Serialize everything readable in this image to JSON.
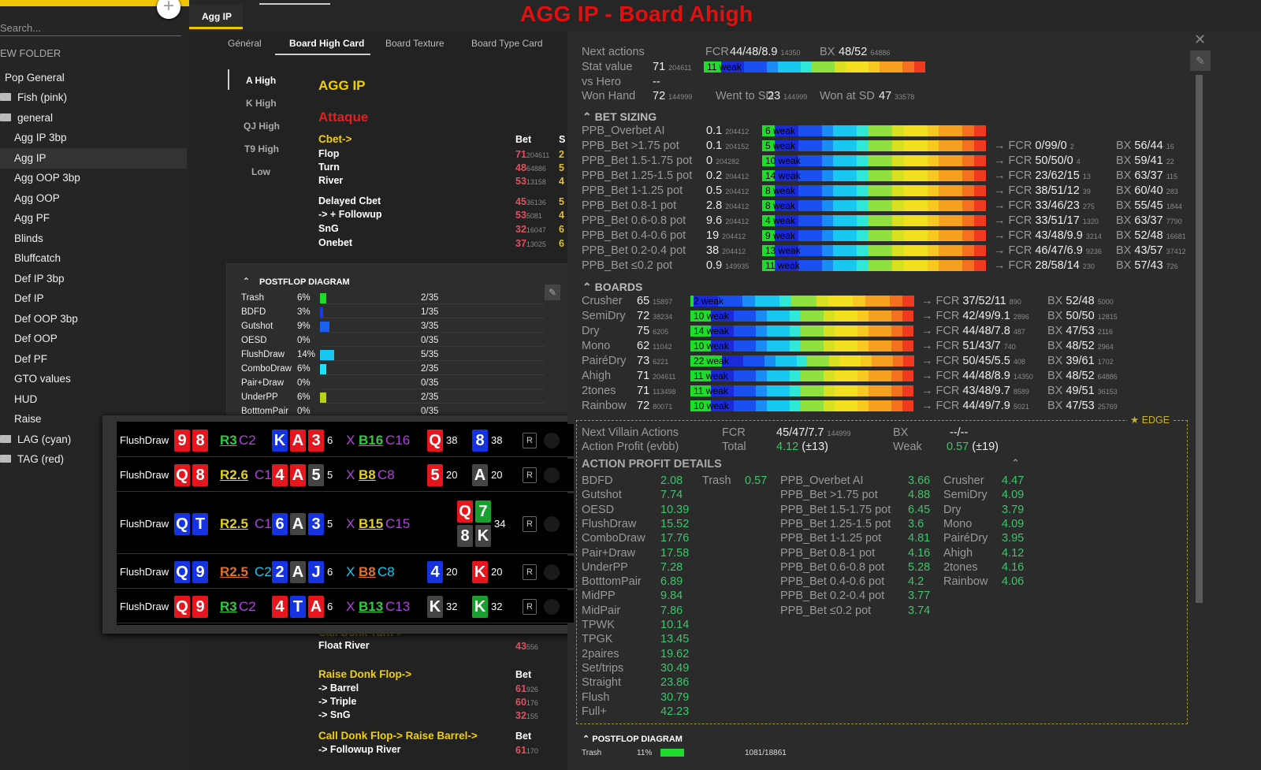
{
  "sidebar": {
    "search_placeholder": "Search...",
    "folder_label": "EW FOLDER",
    "items": [
      {
        "label": "Pop General",
        "folder": false
      },
      {
        "label": "Fish (pink)",
        "folder": true
      },
      {
        "label": "general",
        "folder": true
      },
      {
        "label": "Agg IP 3bp",
        "folder": false
      },
      {
        "label": "Agg IP",
        "folder": false,
        "active": true
      },
      {
        "label": "Agg OOP 3bp",
        "folder": false
      },
      {
        "label": "Agg OOP",
        "folder": false
      },
      {
        "label": "Agg PF",
        "folder": false
      },
      {
        "label": "Blinds",
        "folder": false
      },
      {
        "label": "Bluffcatch",
        "folder": false
      },
      {
        "label": "Def IP 3bp",
        "folder": false
      },
      {
        "label": "Def IP",
        "folder": false
      },
      {
        "label": "Def OOP 3bp",
        "folder": false
      },
      {
        "label": "Def OOP",
        "folder": false
      },
      {
        "label": "Def PF",
        "folder": false
      },
      {
        "label": "GTO values",
        "folder": false
      },
      {
        "label": "HUD",
        "folder": false
      },
      {
        "label": "Raise",
        "folder": false
      },
      {
        "label": "LAG (cyan)",
        "folder": true
      },
      {
        "label": "TAG (red)",
        "folder": true
      }
    ]
  },
  "tab": {
    "label": "Agg IP"
  },
  "page_title": "AGG IP - Board Ahigh",
  "subtabs": [
    "Général",
    "Board High Card",
    "Board Texture",
    "Board Type Card"
  ],
  "high_cards": [
    "A High",
    "K High",
    "QJ High",
    "T9 High",
    "Low"
  ],
  "main": {
    "section_title": "AGG IP",
    "attack": "Attaque",
    "cbet": "Cbet->",
    "bet_col": "Bet",
    "s_col": "S",
    "rows": [
      {
        "label": "Flop",
        "v": "71",
        "n": "204611",
        "s": "2"
      },
      {
        "label": "Turn",
        "v": "48",
        "n": "64886",
        "s": "5"
      },
      {
        "label": "River",
        "v": "53",
        "n": "13158",
        "s": "4"
      },
      {
        "label": "Delayed Cbet",
        "v": "45",
        "n": "36136",
        "s": "5"
      },
      {
        "label": "-> + Followup",
        "v": "53",
        "n": "5081",
        "s": "4"
      },
      {
        "label": "SnG",
        "v": "32",
        "n": "16047",
        "s": "6"
      },
      {
        "label": "Onebet",
        "v": "37",
        "n": "13025",
        "s": "6"
      }
    ],
    "bottom": {
      "call_donk_turn": "Call Donk Turn->",
      "float_river": "Float River",
      "float_v": "43",
      "float_n": "556",
      "raise_donk": "Raise Donk Flop->",
      "barrel": "-> Barrel",
      "barrel_v": "61",
      "barrel_n": "926",
      "triple": "-> Triple",
      "triple_v": "60",
      "triple_n": "176",
      "sng": "-> SnG",
      "sng_v": "32",
      "sng_n": "155",
      "call_donk": "Call Donk Flop-> Raise Barrel->",
      "fr": "-> Followup River",
      "fr_v": "61",
      "fr_n": "170"
    }
  },
  "postflop": {
    "title": "POSTFLOP DIAGRAM",
    "rows": [
      {
        "label": "Trash",
        "pct": "6%",
        "frac": "2/35",
        "value": 0.06,
        "color": "#1fdc2c"
      },
      {
        "label": "BDFD",
        "pct": "3%",
        "frac": "1/35",
        "value": 0.03,
        "color": "#1a3ae8"
      },
      {
        "label": "Gutshot",
        "pct": "9%",
        "frac": "3/35",
        "value": 0.09,
        "color": "#1a5ff0"
      },
      {
        "label": "OESD",
        "pct": "0%",
        "frac": "0/35",
        "value": 0,
        "color": "#1a5ff0"
      },
      {
        "label": "FlushDraw",
        "pct": "14%",
        "frac": "5/35",
        "value": 0.14,
        "color": "#18c8f0"
      },
      {
        "label": "ComboDraw",
        "pct": "6%",
        "frac": "2/35",
        "value": 0.06,
        "color": "#1ee0f8"
      },
      {
        "label": "Pair+Draw",
        "pct": "0%",
        "frac": "0/35",
        "value": 0,
        "color": "#3cf0e0"
      },
      {
        "label": "UnderPP",
        "pct": "6%",
        "frac": "2/35",
        "value": 0.06,
        "color": "#b8d018"
      },
      {
        "label": "BotttomPair",
        "pct": "0%",
        "frac": "0/35",
        "value": 0,
        "color": "#e0d020"
      }
    ]
  },
  "hands": [
    {
      "label": "FlushDraw",
      "cards": [
        [
          "9",
          "r"
        ],
        [
          "8",
          "r"
        ]
      ],
      "rt": "R3",
      "rtc": "#2ecc40",
      "ct": "C2",
      "ctc": "#b040e0",
      "board": [
        [
          "K",
          "b"
        ],
        [
          "A",
          "r"
        ],
        [
          "3",
          "r"
        ]
      ],
      "bn": "6",
      "xt": "X",
      "xtc": "#b040e0",
      "xb": "B16",
      "xbc": "#2ecc40",
      "xc": "C16",
      "xcc": "#b040e0",
      "t1": [
        "Q",
        "r"
      ],
      "t1n": "38",
      "t2": [
        "8",
        "b"
      ],
      "t2n": "38"
    },
    {
      "label": "FlushDraw",
      "cards": [
        [
          "Q",
          "r"
        ],
        [
          "8",
          "r"
        ]
      ],
      "rt": "R2.6",
      "rtc": "#e0d020",
      "ct": "C1.6",
      "ctc": "#b040e0",
      "board": [
        [
          "4",
          "r"
        ],
        [
          "A",
          "r"
        ],
        [
          "5",
          "k"
        ]
      ],
      "bn": "5",
      "xt": "X",
      "xtc": "#b040e0",
      "xb": "B8",
      "xbc": "#e0d020",
      "xc": "C8",
      "xcc": "#b040e0",
      "t1": [
        "5",
        "r"
      ],
      "t1n": "20",
      "t2": [
        "A",
        "k"
      ],
      "t2n": "20"
    },
    {
      "label": "FlushDraw",
      "cards": [
        [
          "Q",
          "b"
        ],
        [
          "T",
          "b"
        ]
      ],
      "rt": "R2.5",
      "rtc": "#e0d020",
      "ct": "C1.5",
      "ctc": "#b040e0",
      "board": [
        [
          "6",
          "b"
        ],
        [
          "A",
          "k"
        ],
        [
          "3",
          "b"
        ]
      ],
      "bn": "5",
      "xt": "X",
      "xtc": "#b040e0",
      "xb": "B15",
      "xbc": "#e0d020",
      "xc": "C15",
      "xcc": "#b040e0",
      "quad": [
        [
          "Q",
          "r"
        ],
        [
          "7",
          "g"
        ],
        [
          "8",
          "k"
        ],
        [
          "K",
          "k"
        ]
      ],
      "qn": "34"
    },
    {
      "label": "FlushDraw",
      "cards": [
        [
          "Q",
          "b"
        ],
        [
          "9",
          "b"
        ]
      ],
      "rt": "R2.5",
      "rtc": "#e07030",
      "ct": "C2",
      "ctc": "#18c8f0",
      "board": [
        [
          "2",
          "b"
        ],
        [
          "A",
          "k"
        ],
        [
          "J",
          "b"
        ]
      ],
      "bn": "6",
      "xt": "X",
      "xtc": "#18c8f0",
      "xb": "B8",
      "xbc": "#e07030",
      "xc": "C8",
      "xcc": "#18c8f0",
      "t1": [
        "4",
        "b"
      ],
      "t1n": "20",
      "t2": [
        "K",
        "r"
      ],
      "t2n": "20"
    },
    {
      "label": "FlushDraw",
      "cards": [
        [
          "Q",
          "r"
        ],
        [
          "9",
          "r"
        ]
      ],
      "rt": "R3",
      "rtc": "#2ecc40",
      "ct": "C2",
      "ctc": "#b040e0",
      "board": [
        [
          "4",
          "r"
        ],
        [
          "T",
          "b"
        ],
        [
          "A",
          "r"
        ]
      ],
      "bn": "6",
      "xt": "X",
      "xtc": "#b040e0",
      "xb": "B13",
      "xbc": "#2ecc40",
      "xc": "C13",
      "xcc": "#b040e0",
      "t1": [
        "K",
        "k"
      ],
      "t1n": "32",
      "t2": [
        "K",
        "g"
      ],
      "t2n": "32"
    }
  ],
  "hands_r": "R",
  "stats": {
    "next_actions": "Next actions",
    "na_fcr": "FCR",
    "na_fcr_v": "44/48/8.9",
    "na_fcr_n": "14350",
    "na_bx": "BX",
    "na_bx_v": "48/52",
    "na_bx_n": "64886",
    "stat_value": "Stat value",
    "sv": "71",
    "sv_n": "204611",
    "sv_tag": "11 weak",
    "vs_hero": "vs Hero",
    "vs_hero_v": "--",
    "won_hand": "Won Hand",
    "wh": "72",
    "wh_n": "144999",
    "wtsd": "Went to SD",
    "wtsd_v": "23",
    "wtsd_n": "144999",
    "wsd": "Won at SD",
    "wsd_v": "47",
    "wsd_n": "33578",
    "bet_sizing": "BET SIZING",
    "bs_rows": [
      {
        "l": "PPB_Overbet AI",
        "v": "0.1",
        "n": "204412",
        "tag": "6 weak",
        "fcr": "",
        "fn": "",
        "bx": "",
        "bn": ""
      },
      {
        "l": "PPB_Bet >1.75 pot",
        "v": "0.1",
        "n": "204152",
        "tag": "5 weak",
        "fcr": "0/99/0",
        "fn": "2",
        "bx": "56/44",
        "bn": "16"
      },
      {
        "l": "PPB_Bet 1.5-1.75 pot",
        "v": "0",
        "n": "204282",
        "tag": "10 weak",
        "fcr": "50/50/0",
        "fn": "4",
        "bx": "59/41",
        "bn": "22"
      },
      {
        "l": "PPB_Bet 1.25-1.5 pot",
        "v": "0.2",
        "n": "204412",
        "tag": "14 weak",
        "fcr": "23/62/15",
        "fn": "13",
        "bx": "63/37",
        "bn": "115"
      },
      {
        "l": "PPB_Bet 1-1.25 pot",
        "v": "0.5",
        "n": "204412",
        "tag": "8 weak",
        "fcr": "38/51/12",
        "fn": "39",
        "bx": "60/40",
        "bn": "283"
      },
      {
        "l": "PPB_Bet 0.8-1 pot",
        "v": "2.8",
        "n": "204412",
        "tag": "8 weak",
        "fcr": "33/46/23",
        "fn": "275",
        "bx": "55/45",
        "bn": "1844"
      },
      {
        "l": "PPB_Bet 0.6-0.8 pot",
        "v": "9.6",
        "n": "204412",
        "tag": "4 weak",
        "fcr": "33/51/17",
        "fn": "1320",
        "bx": "63/37",
        "bn": "7790"
      },
      {
        "l": "PPB_Bet 0.4-0.6 pot",
        "v": "19",
        "n": "204412",
        "tag": "9 weak",
        "fcr": "43/48/9.9",
        "fn": "3214",
        "bx": "52/48",
        "bn": "16681"
      },
      {
        "l": "PPB_Bet 0.2-0.4 pot",
        "v": "38",
        "n": "204412",
        "tag": "13 weak",
        "fcr": "46/47/6.9",
        "fn": "9236",
        "bx": "43/57",
        "bn": "37412"
      },
      {
        "l": "PPB_Bet ≤0.2 pot",
        "v": "0.9",
        "n": "149935",
        "tag": "11 weak",
        "fcr": "28/58/14",
        "fn": "230",
        "bx": "57/43",
        "bn": "726"
      }
    ],
    "boards": "BOARDS",
    "bd_rows": [
      {
        "l": "Crusher",
        "v": "65",
        "n": "15897",
        "tag": "2 weak",
        "fcr": "37/52/11",
        "fn": "890",
        "bx": "52/48",
        "bn": "5000"
      },
      {
        "l": "SemiDry",
        "v": "72",
        "n": "38234",
        "tag": "10 weak",
        "fcr": "42/49/9.1",
        "fn": "2896",
        "bx": "50/50",
        "bn": "12815"
      },
      {
        "l": "Dry",
        "v": "75",
        "n": "6205",
        "tag": "14 weak",
        "fcr": "44/48/7.8",
        "fn": "487",
        "bx": "47/53",
        "bn": "2116"
      },
      {
        "l": "Mono",
        "v": "62",
        "n": "11042",
        "tag": "10 weak",
        "fcr": "51/43/7",
        "fn": "740",
        "bx": "48/52",
        "bn": "2964"
      },
      {
        "l": "PairéDry",
        "v": "73",
        "n": "6221",
        "tag": "22 weak",
        "fcr": "50/45/5.5",
        "fn": "408",
        "bx": "39/61",
        "bn": "1702"
      },
      {
        "l": "Ahigh",
        "v": "71",
        "n": "204611",
        "tag": "11 weak",
        "fcr": "44/48/8.9",
        "fn": "14350",
        "bx": "48/52",
        "bn": "64886"
      },
      {
        "l": "2tones",
        "v": "71",
        "n": "113498",
        "tag": "11 weak",
        "fcr": "43/48/9.7",
        "fn": "8589",
        "bx": "49/51",
        "bn": "36153"
      },
      {
        "l": "Rainbow",
        "v": "72",
        "n": "80071",
        "tag": "10 weak",
        "fcr": "44/49/7.9",
        "fn": "5021",
        "bx": "47/53",
        "bn": "25769"
      }
    ],
    "edge": "EDGE",
    "nva": "Next Villain Actions",
    "nva_fcr": "FCR",
    "nva_fcr_v": "45/47/7.7",
    "nva_fcr_n": "144999",
    "nva_bx": "BX",
    "nva_bx_v": "--/--",
    "ap": "Action Profit (evbb)",
    "ap_total": "Total",
    "ap_total_v": "4.12",
    "ap_total_e": "(±13)",
    "ap_weak": "Weak",
    "ap_weak_v": "0.57",
    "ap_weak_e": "(±19)",
    "apd": "ACTION PROFIT DETAILS",
    "apd_c1": [
      [
        "BDFD",
        "2.08"
      ],
      [
        "Gutshot",
        "7.74"
      ],
      [
        "OESD",
        "10.39"
      ],
      [
        "FlushDraw",
        "15.52"
      ],
      [
        "ComboDraw",
        "17.76"
      ],
      [
        "Pair+Draw",
        "17.58"
      ],
      [
        "UnderPP",
        "7.28"
      ],
      [
        "BotttomPair",
        "6.89"
      ],
      [
        "MidPP",
        "9.84"
      ],
      [
        "MidPair",
        "7.86"
      ],
      [
        "TPWK",
        "10.14"
      ],
      [
        "TPGK",
        "13.45"
      ],
      [
        "2paires",
        "19.62"
      ],
      [
        "Set/trips",
        "30.49"
      ],
      [
        "Straight",
        "23.86"
      ],
      [
        "Flush",
        "30.79"
      ],
      [
        "Full+",
        "42.23"
      ]
    ],
    "apd_trash": [
      "Trash",
      "0.57"
    ],
    "apd_c2": [
      [
        "PPB_Overbet AI",
        "3.66"
      ],
      [
        "PPB_Bet >1.75 pot",
        "4.88"
      ],
      [
        "PPB_Bet 1.5-1.75 pot",
        "6.45"
      ],
      [
        "PPB_Bet 1.25-1.5 pot",
        "3.6"
      ],
      [
        "PPB_Bet 1-1.25 pot",
        "4.81"
      ],
      [
        "PPB_Bet 0.8-1 pot",
        "4.16"
      ],
      [
        "PPB_Bet 0.6-0.8 pot",
        "5.28"
      ],
      [
        "PPB_Bet 0.4-0.6 pot",
        "4.2"
      ],
      [
        "PPB_Bet 0.2-0.4 pot",
        "3.77"
      ],
      [
        "PPB_Bet ≤0.2 pot",
        "3.74"
      ]
    ],
    "apd_c3": [
      [
        "Crusher",
        "4.47"
      ],
      [
        "SemiDry",
        "4.09"
      ],
      [
        "Dry",
        "3.79"
      ],
      [
        "Mono",
        "4.09"
      ],
      [
        "PairéDry",
        "3.95"
      ],
      [
        "Ahigh",
        "4.12"
      ],
      [
        "2tones",
        "4.16"
      ],
      [
        "Rainbow",
        "4.06"
      ]
    ],
    "pfd2": "POSTFLOP DIAGRAM",
    "pfd2_l": "Trash",
    "pfd2_p": "11%",
    "pfd2_f": "1081/18861"
  }
}
